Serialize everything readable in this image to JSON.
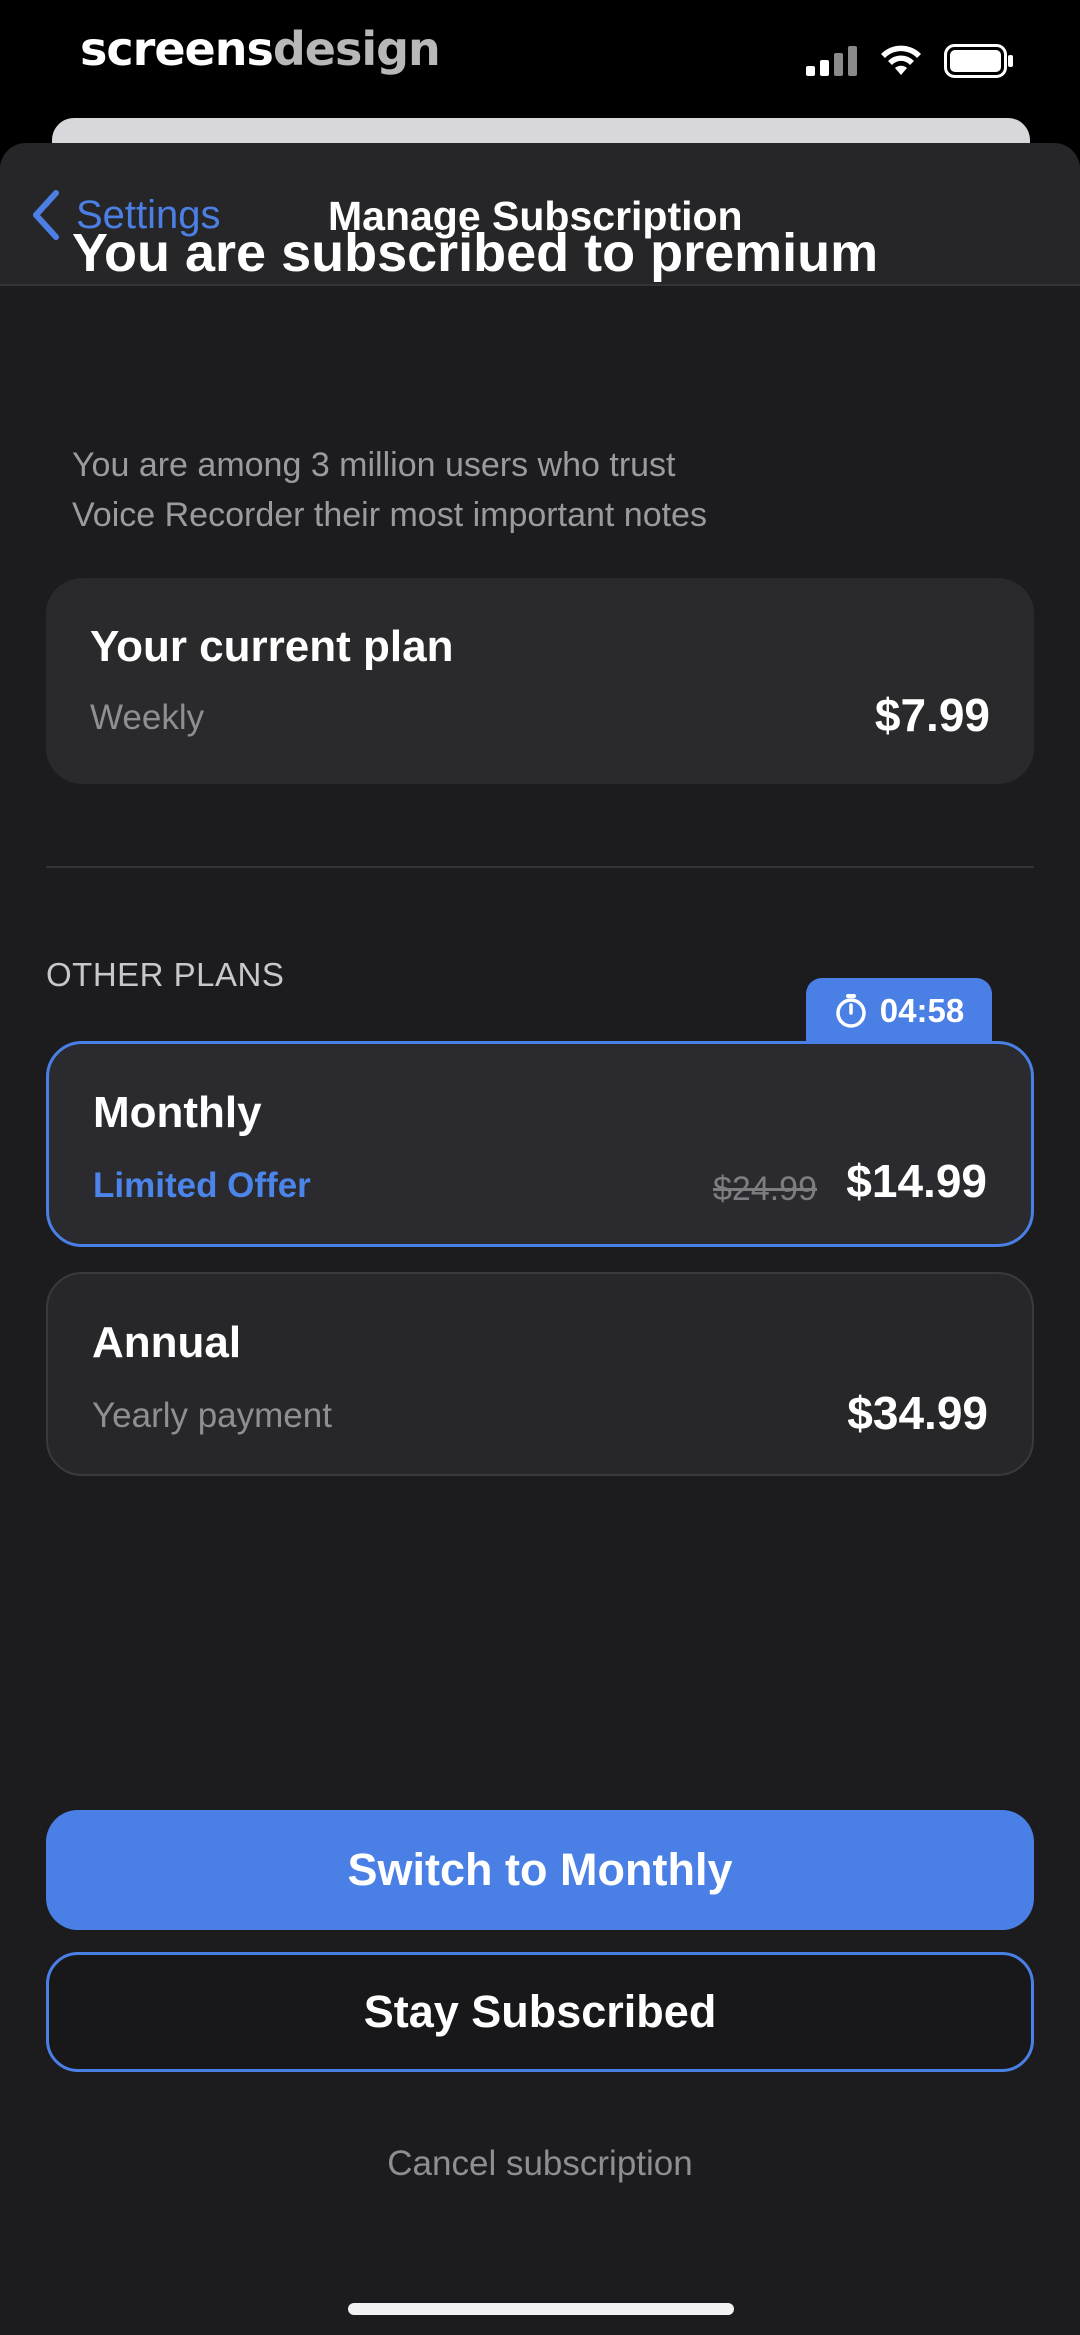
{
  "status_bar": {
    "brand_part1": "screens",
    "brand_part2": "design",
    "icons": [
      "signal-icon",
      "wifi-icon",
      "battery-icon"
    ]
  },
  "nav": {
    "back_label": "Settings",
    "title": "Manage Subscription"
  },
  "header": {
    "headline": "You are subscribed to premium",
    "subtitle_line1": "You are among 3 million users who trust",
    "subtitle_line2": "Voice Recorder their most important notes"
  },
  "current_plan": {
    "title": "Your current plan",
    "period": "Weekly",
    "price": "$7.99"
  },
  "other_plans": {
    "section_label": "OTHER PLANS",
    "timer": "04:58",
    "plans": [
      {
        "name": "Monthly",
        "subtitle": "Limited Offer",
        "old_price": "$24.99",
        "price": "$14.99",
        "selected": true
      },
      {
        "name": "Annual",
        "subtitle": "Yearly payment",
        "price": "$34.99",
        "selected": false
      }
    ]
  },
  "actions": {
    "primary": "Switch to Monthly",
    "secondary": "Stay Subscribed",
    "cancel": "Cancel subscription"
  },
  "colors": {
    "accent": "#4a7fe6",
    "background": "#1c1c1e",
    "card": "#2a2a2d"
  }
}
